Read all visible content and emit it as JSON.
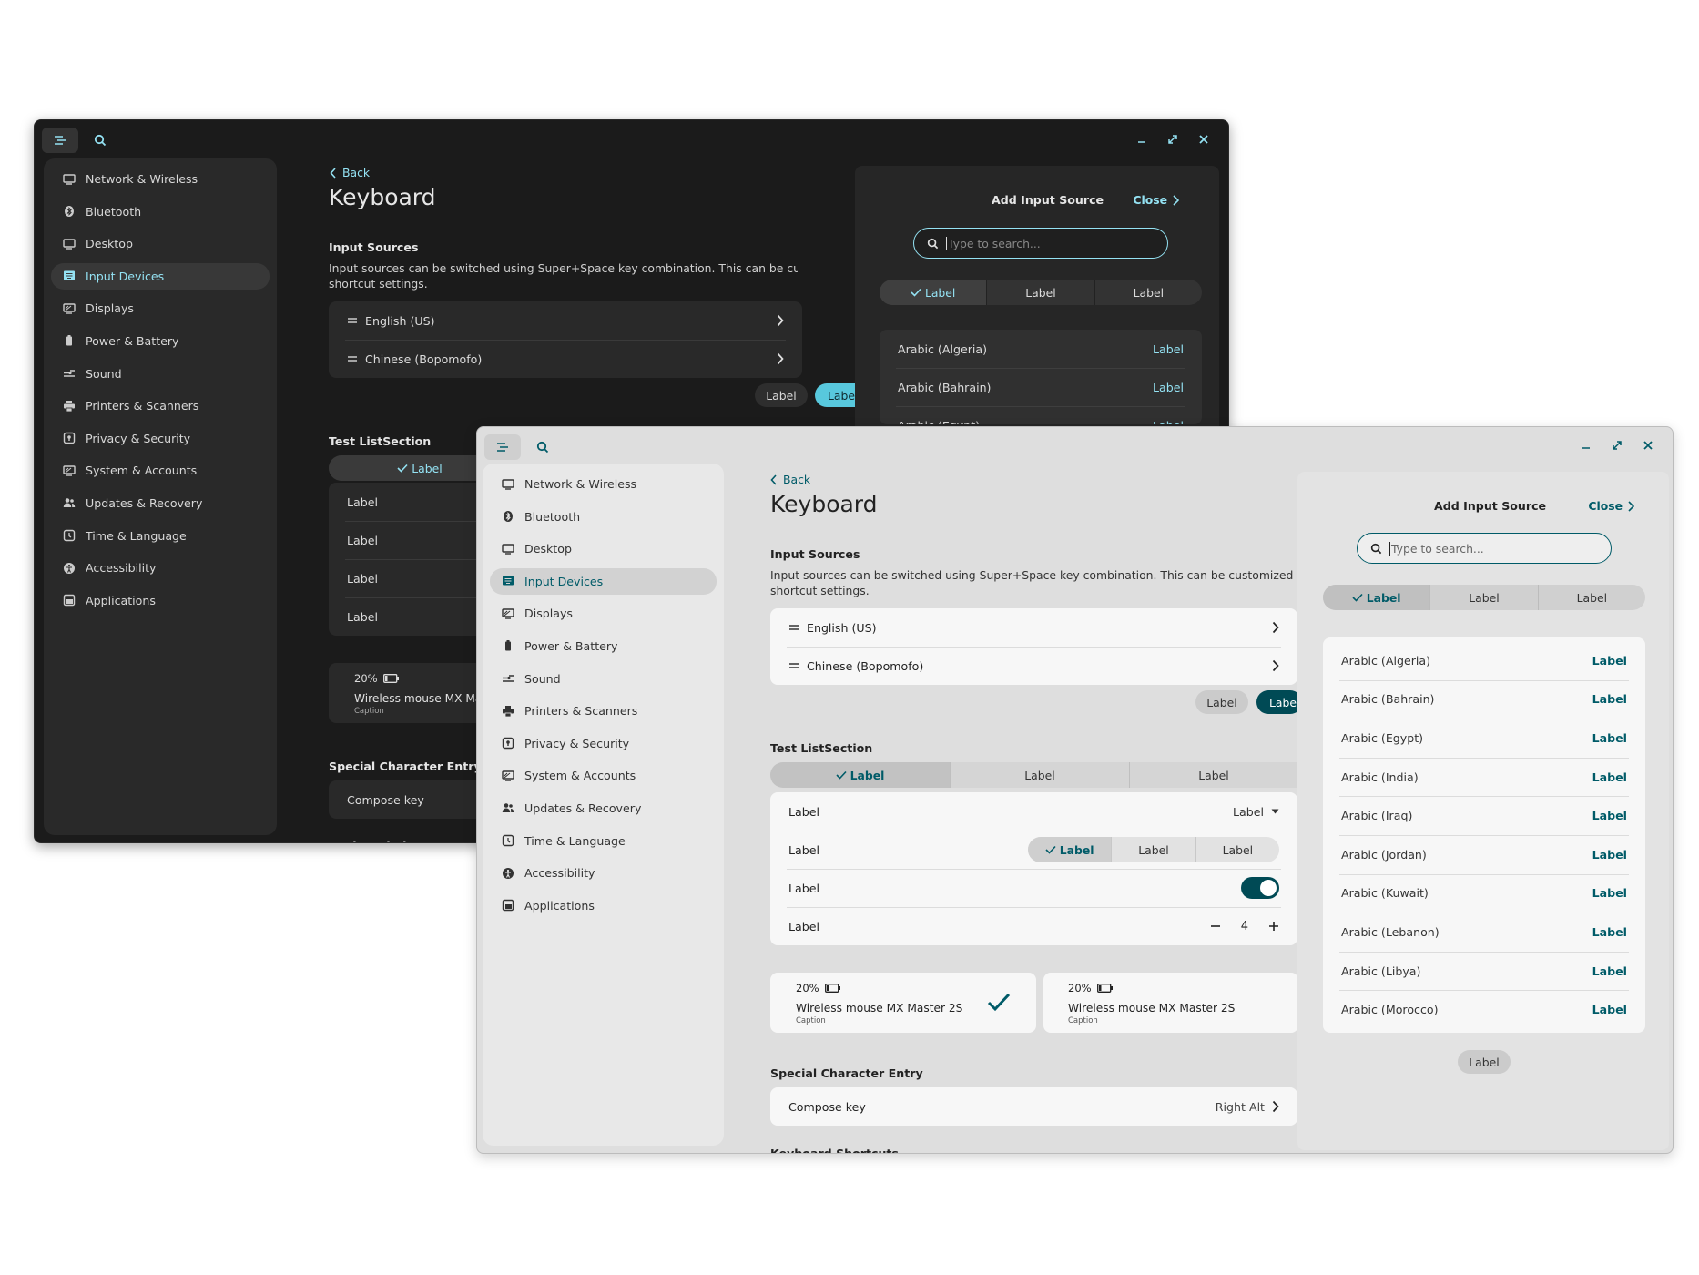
{
  "sidebar_items": [
    {
      "label": "Network & Wireless",
      "icon": "monitor-network-icon"
    },
    {
      "label": "Bluetooth",
      "icon": "bluetooth-icon"
    },
    {
      "label": "Desktop",
      "icon": "desktop-icon"
    },
    {
      "label": "Input Devices",
      "icon": "input-devices-icon"
    },
    {
      "label": "Displays",
      "icon": "displays-icon"
    },
    {
      "label": "Power & Battery",
      "icon": "battery-icon"
    },
    {
      "label": "Sound",
      "icon": "sound-icon"
    },
    {
      "label": "Printers & Scanners",
      "icon": "printer-icon"
    },
    {
      "label": "Privacy & Security",
      "icon": "shield-icon"
    },
    {
      "label": "System & Accounts",
      "icon": "system-icon"
    },
    {
      "label": "Updates & Recovery",
      "icon": "users-icon"
    },
    {
      "label": "Time & Language",
      "icon": "clock-icon"
    },
    {
      "label": "Accessibility",
      "icon": "accessibility-icon"
    },
    {
      "label": "Applications",
      "icon": "applications-icon"
    }
  ],
  "page": {
    "back": "Back",
    "title": "Keyboard",
    "input_sources_heading": "Input Sources",
    "input_sources_desc_line1": "Input sources can be switched using Super+Space key combination. This can be customized in the keyboa",
    "input_sources_desc_line2": "shortcut settings.",
    "sources": [
      "English (US)",
      "Chinese (Bopomofo)"
    ],
    "button_label": "Label",
    "button_primary_dark": "Labe",
    "button_primary_light": "Labe",
    "test_section_heading": "Test ListSection",
    "segmented": [
      "Label",
      "Label",
      "Label"
    ],
    "test_rows": [
      "Label",
      "Label",
      "Label",
      "Label"
    ],
    "dropdown_value": "Label",
    "stepper_value": "4",
    "battery": "20%",
    "device_name": "Wireless mouse MX Master 2S",
    "device_name_dark_truncated": "Wireless mouse MX Mast",
    "device_caption": "Caption",
    "special_heading": "Special Character Entry",
    "compose_label": "Compose key",
    "compose_value": "Right Alt",
    "next_heading_partial": "Keyboard Shortcuts"
  },
  "panel": {
    "title": "Add Input Source",
    "close": "Close",
    "search_placeholder": "Type to search...",
    "segmented": [
      "Label",
      "Label",
      "Label"
    ],
    "action": "Label",
    "languages": [
      "Arabic (Algeria)",
      "Arabic (Bahrain)",
      "Arabic (Egypt)",
      "Arabic (India)",
      "Arabic (Iraq)",
      "Arabic (Jordan)",
      "Arabic (Kuwait)",
      "Arabic (Lebanon)",
      "Arabic (Libya)",
      "Arabic (Morocco)"
    ],
    "footer_button": "Label"
  },
  "colors": {
    "dark_bg": "#1b1b1b",
    "dark_accent": "#94e2f3",
    "light_bg": "#dedede",
    "light_accent": "#005b68"
  }
}
